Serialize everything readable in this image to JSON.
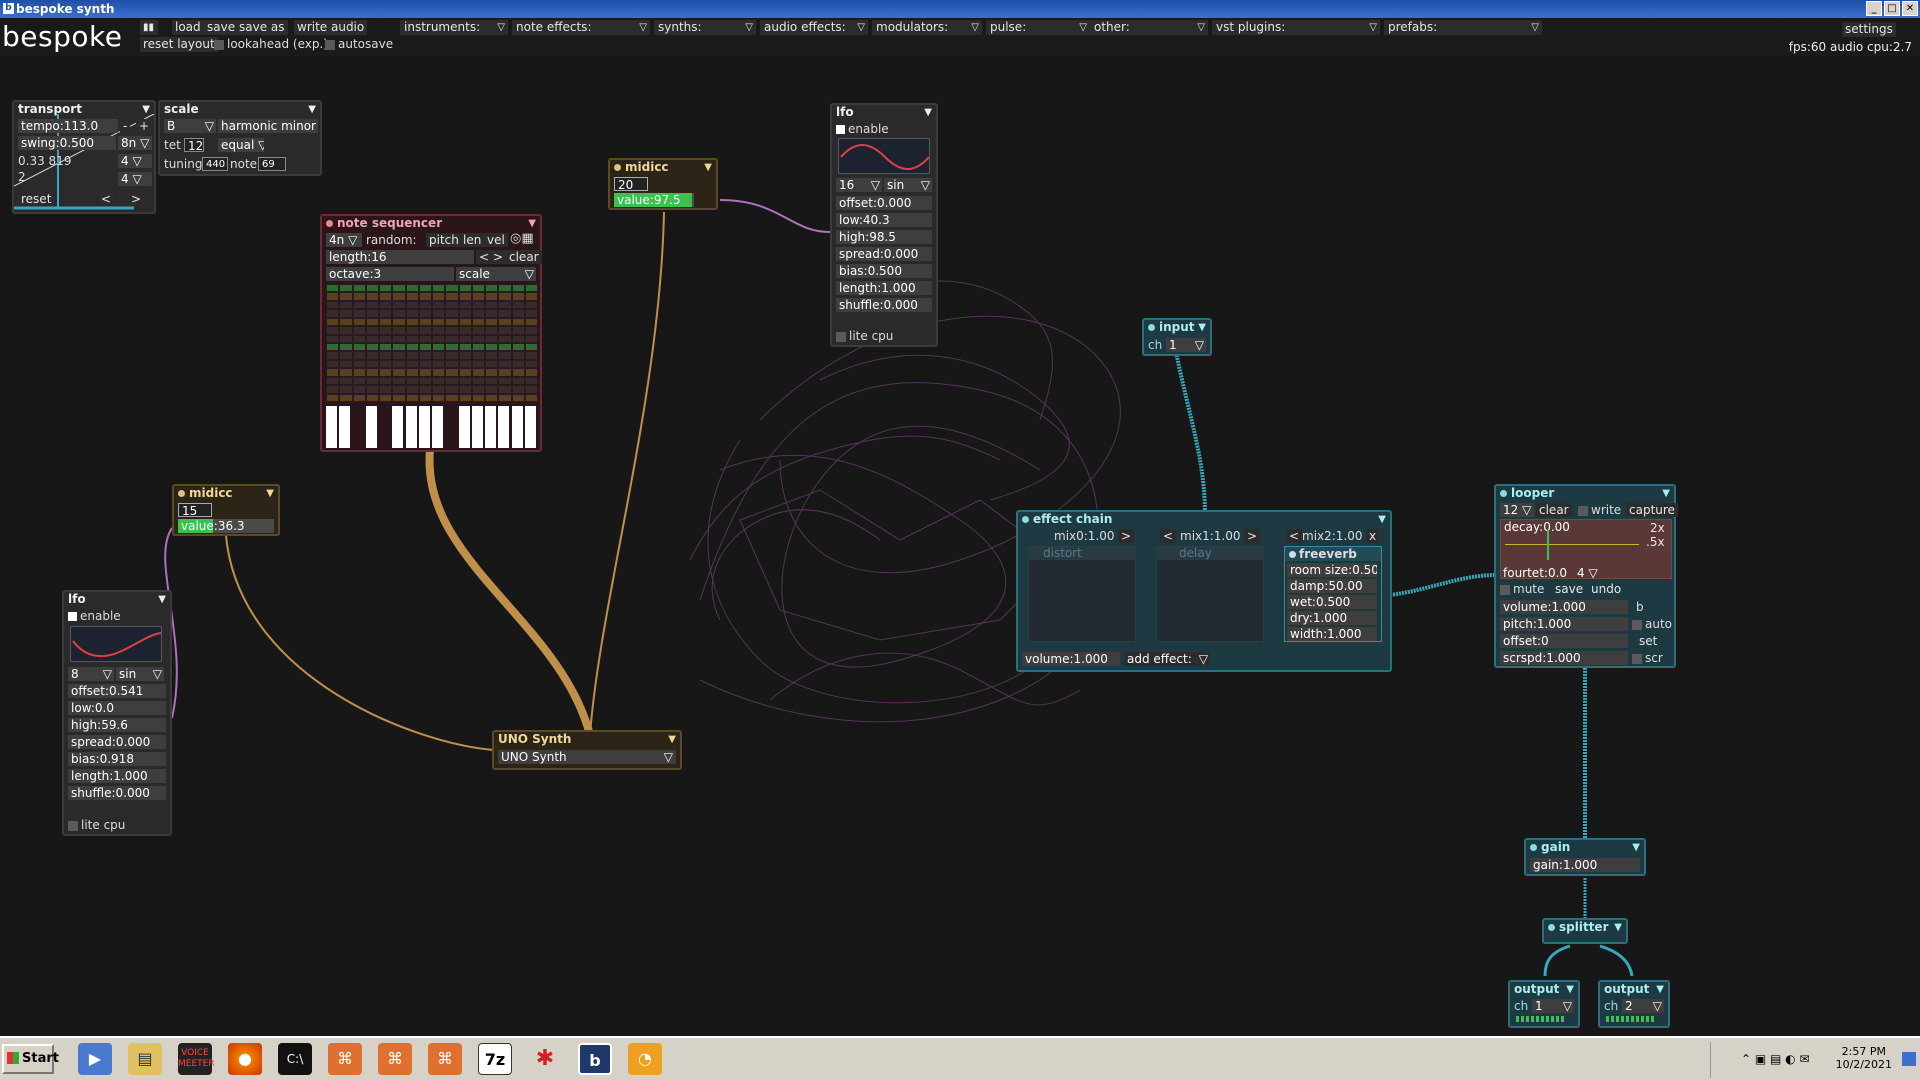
{
  "window": {
    "title": "bespoke synth",
    "controls": [
      "_",
      "□",
      "✕"
    ]
  },
  "topbar": {
    "brand": "bespoke",
    "buttons": [
      "load",
      "save",
      "save as",
      "write audio"
    ],
    "row2": {
      "reset_layout": "reset layout",
      "lookahead": "lookahead (exp.)",
      "autosave": "autosave"
    },
    "menus": [
      "instruments:",
      "note effects:",
      "synths:",
      "audio effects:",
      "modulators:",
      "pulse:",
      "other:",
      "vst plugins:",
      "prefabs:"
    ],
    "settings": "settings",
    "status": "fps:60  audio cpu:2.7"
  },
  "transport": {
    "title": "transport",
    "tempo": "tempo:113.0",
    "minus": "-",
    "plus": "+",
    "swing": "swing:0.500",
    "swing_div": "8n",
    "ratio": "0.33",
    "ratio2": "819",
    "sig_top": "4",
    "sig_bot": "4",
    "sig_extra": "4",
    "two": "2",
    "reset": "reset",
    "prev": "<",
    "next": ">"
  },
  "scale": {
    "title": "scale",
    "root": "B",
    "mode": "harmonic minor",
    "tet_label": "tet",
    "tet": "12",
    "tuning_mode": "equal",
    "tuning_label": "tuning",
    "tuning": "440",
    "note_label": "note",
    "note": "69"
  },
  "note_sequencer": {
    "title": "note sequencer",
    "div": "4n",
    "random_label": "random:",
    "random_opts": [
      "pitch",
      "len",
      "vel"
    ],
    "length": "length:16",
    "prev": "<",
    "next": ">",
    "clear": "clear",
    "octave": "octave:3",
    "scale": "scale"
  },
  "midicc_top": {
    "title": "midicc",
    "cc": "20",
    "value": "value:97.5",
    "value_fraction": 0.975
  },
  "midicc_left": {
    "title": "midicc",
    "cc": "15",
    "value": "value:36.3",
    "value_fraction": 0.363
  },
  "lfo_top": {
    "title": "lfo",
    "enable": "enable",
    "div": "16",
    "wave": "sin",
    "offset": "offset:0.000",
    "low": "low:40.3",
    "high": "high:98.5",
    "spread": "spread:0.000",
    "bias": "bias:0.500",
    "length": "length:1.000",
    "shuffle": "shuffle:0.000",
    "lite_cpu": "lite cpu"
  },
  "lfo_left": {
    "title": "lfo",
    "enable": "enable",
    "div": "8",
    "wave": "sin",
    "offset": "offset:0.541",
    "low": "low:0.0",
    "high": "high:59.6",
    "spread": "spread:0.000",
    "bias": "bias:0.918",
    "length": "length:1.000",
    "shuffle": "shuffle:0.000",
    "lite_cpu": "lite cpu"
  },
  "uno": {
    "title": "UNO Synth",
    "device": "UNO Synth"
  },
  "input": {
    "title": "input",
    "ch_label": "ch",
    "ch": "1"
  },
  "effect_chain": {
    "title": "effect chain",
    "mix0": "mix0:1.00",
    "mix1": "mix1:1.00",
    "mix2": "mix2:1.00",
    "prev": "<",
    "next": ">",
    "close": "x",
    "distort": "distort",
    "delay": "delay",
    "volume": "volume:1.000",
    "add_effect": "add effect:"
  },
  "freeverb": {
    "title": "freeverb",
    "room_size": "room size:0.50",
    "damp": "damp:50.00",
    "wet": "wet:0.500",
    "dry": "dry:1.000",
    "width": "width:1.000"
  },
  "looper": {
    "title": "looper",
    "bars": "12",
    "clear": "clear",
    "write": "write",
    "capture": "capture",
    "decay": "decay:0.00",
    "x2": "2x",
    "x5": ".5x",
    "fourtet": "fourtet:0.0",
    "fourtet_n": "4",
    "mute": "mute",
    "save": "save",
    "undo": "undo",
    "volume": "volume:1.000",
    "b": "b",
    "pitch": "pitch:1.000",
    "auto": "auto",
    "offset": "offset:0",
    "set": "set",
    "scrspd": "scrspd:1.000",
    "scr": "scr"
  },
  "gain": {
    "title": "gain",
    "gain": "gain:1.000"
  },
  "splitter": {
    "title": "splitter"
  },
  "output1": {
    "title": "output",
    "ch_label": "ch",
    "ch": "1"
  },
  "output2": {
    "title": "output",
    "ch_label": "ch",
    "ch": "2"
  },
  "taskbar": {
    "start": "Start",
    "apps": [
      "media-player-icon",
      "file-manager-icon",
      "voicemeeter-icon",
      "firefox-icon",
      "terminal-icon",
      "app-icon",
      "app-icon",
      "app-icon",
      "7zip-icon",
      "bug-icon",
      "bespoke-icon",
      "pdf-icon"
    ],
    "voicemeeter_label": "VOICE MEETER",
    "sevenzip_label": "7z",
    "bespoke_label": "b",
    "time": "2:57 PM",
    "date": "10/2/2021"
  },
  "colors": {
    "teal": "#35a9bd",
    "brown": "#c0904a",
    "purple": "#b070c0",
    "red": "#e03040",
    "green": "#3cc050"
  }
}
